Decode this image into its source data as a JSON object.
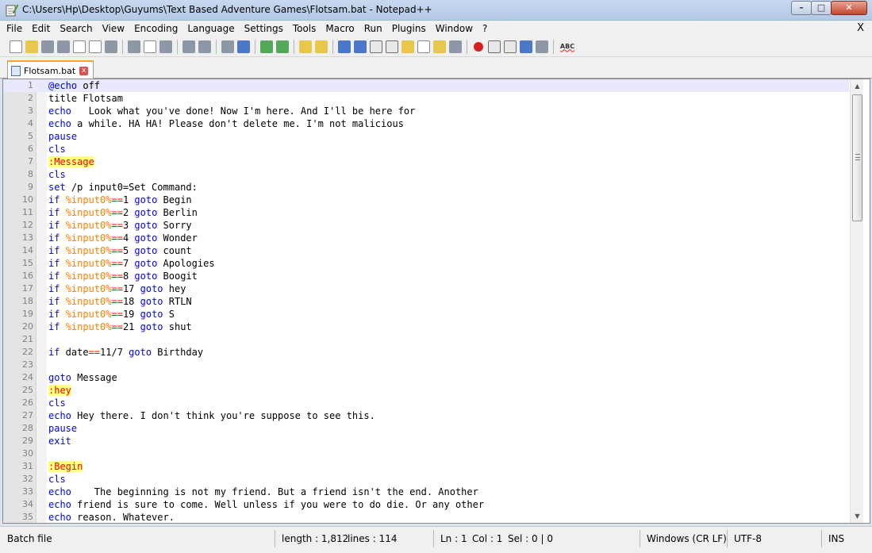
{
  "window": {
    "title": "C:\\Users\\Hp\\Desktop\\Guyums\\Text Based Adventure Games\\Flotsam.bat - Notepad++",
    "minimize": "–",
    "maximize": "□",
    "close": "✕"
  },
  "menu": {
    "items": [
      "File",
      "Edit",
      "Search",
      "View",
      "Encoding",
      "Language",
      "Settings",
      "Tools",
      "Macro",
      "Run",
      "Plugins",
      "Window",
      "?"
    ],
    "close_doc": "X"
  },
  "toolbar": {
    "icons": [
      "new-file-icon",
      "open-file-icon",
      "save-icon",
      "save-all-icon",
      "close-icon",
      "close-all-icon",
      "print-icon",
      "cut-icon",
      "copy-icon",
      "paste-icon",
      "undo-icon",
      "redo-icon",
      "find-icon",
      "replace-icon",
      "zoom-in-icon",
      "zoom-out-icon",
      "sync-vertical-icon",
      "sync-horizontal-icon",
      "word-wrap-icon",
      "show-all-chars-icon",
      "indent-guide-icon",
      "user-defined-language-icon",
      "doc-map-icon",
      "function-list-icon",
      "folder-as-workspace-icon",
      "monitor-icon",
      "record-macro-icon",
      "stop-record-icon",
      "play-macro-icon",
      "run-macro-multiple-icon",
      "save-macro-icon",
      "spell-check-icon"
    ],
    "spell_check_label": "ABC"
  },
  "tab": {
    "label": "Flotsam.bat",
    "close": "x"
  },
  "editor": {
    "lines": [
      [
        {
          "t": "@echo",
          "c": "kw"
        },
        {
          "t": " off",
          "c": ""
        }
      ],
      [
        {
          "t": "title Flotsam",
          "c": ""
        }
      ],
      [
        {
          "t": "echo",
          "c": "kw"
        },
        {
          "t": "   Look what you've done! Now I'm here. And I'll be here for",
          "c": ""
        }
      ],
      [
        {
          "t": "echo",
          "c": "kw"
        },
        {
          "t": " a while. HA HA! Please don't delete me. I'm not malicious",
          "c": ""
        }
      ],
      [
        {
          "t": "pause",
          "c": "kw"
        }
      ],
      [
        {
          "t": "cls",
          "c": "kw"
        }
      ],
      [
        {
          "t": ":Message",
          "c": "lbl"
        }
      ],
      [
        {
          "t": "cls",
          "c": "kw"
        }
      ],
      [
        {
          "t": "set",
          "c": "kw"
        },
        {
          "t": " /p input0=Set Command:",
          "c": ""
        }
      ],
      [
        {
          "t": "if",
          "c": "kw"
        },
        {
          "t": " ",
          "c": ""
        },
        {
          "t": "%input0%",
          "c": "var"
        },
        {
          "t": "==",
          "c": "op"
        },
        {
          "t": "1 ",
          "c": ""
        },
        {
          "t": "goto",
          "c": "kw"
        },
        {
          "t": " Begin",
          "c": ""
        }
      ],
      [
        {
          "t": "if",
          "c": "kw"
        },
        {
          "t": " ",
          "c": ""
        },
        {
          "t": "%input0%",
          "c": "var"
        },
        {
          "t": "==",
          "c": "op"
        },
        {
          "t": "2 ",
          "c": ""
        },
        {
          "t": "goto",
          "c": "kw"
        },
        {
          "t": " Berlin",
          "c": ""
        }
      ],
      [
        {
          "t": "if",
          "c": "kw"
        },
        {
          "t": " ",
          "c": ""
        },
        {
          "t": "%input0%",
          "c": "var"
        },
        {
          "t": "==",
          "c": "op"
        },
        {
          "t": "3 ",
          "c": ""
        },
        {
          "t": "goto",
          "c": "kw"
        },
        {
          "t": " Sorry",
          "c": ""
        }
      ],
      [
        {
          "t": "if",
          "c": "kw"
        },
        {
          "t": " ",
          "c": ""
        },
        {
          "t": "%input0%",
          "c": "var"
        },
        {
          "t": "==",
          "c": "op"
        },
        {
          "t": "4 ",
          "c": ""
        },
        {
          "t": "goto",
          "c": "kw"
        },
        {
          "t": " Wonder",
          "c": ""
        }
      ],
      [
        {
          "t": "if",
          "c": "kw"
        },
        {
          "t": " ",
          "c": ""
        },
        {
          "t": "%input0%",
          "c": "var"
        },
        {
          "t": "==",
          "c": "op"
        },
        {
          "t": "5 ",
          "c": ""
        },
        {
          "t": "goto",
          "c": "kw"
        },
        {
          "t": " count",
          "c": ""
        }
      ],
      [
        {
          "t": "if",
          "c": "kw"
        },
        {
          "t": " ",
          "c": ""
        },
        {
          "t": "%input0%",
          "c": "var"
        },
        {
          "t": "==",
          "c": "op"
        },
        {
          "t": "7 ",
          "c": ""
        },
        {
          "t": "goto",
          "c": "kw"
        },
        {
          "t": " Apologies",
          "c": ""
        }
      ],
      [
        {
          "t": "if",
          "c": "kw"
        },
        {
          "t": " ",
          "c": ""
        },
        {
          "t": "%input0%",
          "c": "var"
        },
        {
          "t": "==",
          "c": "op"
        },
        {
          "t": "8 ",
          "c": ""
        },
        {
          "t": "goto",
          "c": "kw"
        },
        {
          "t": " Boogit",
          "c": ""
        }
      ],
      [
        {
          "t": "if",
          "c": "kw"
        },
        {
          "t": " ",
          "c": ""
        },
        {
          "t": "%input0%",
          "c": "var"
        },
        {
          "t": "==",
          "c": "op"
        },
        {
          "t": "17 ",
          "c": ""
        },
        {
          "t": "goto",
          "c": "kw"
        },
        {
          "t": " hey",
          "c": ""
        }
      ],
      [
        {
          "t": "if",
          "c": "kw"
        },
        {
          "t": " ",
          "c": ""
        },
        {
          "t": "%input0%",
          "c": "var"
        },
        {
          "t": "==",
          "c": "op"
        },
        {
          "t": "18 ",
          "c": ""
        },
        {
          "t": "goto",
          "c": "kw"
        },
        {
          "t": " RTLN",
          "c": ""
        }
      ],
      [
        {
          "t": "if",
          "c": "kw"
        },
        {
          "t": " ",
          "c": ""
        },
        {
          "t": "%input0%",
          "c": "var"
        },
        {
          "t": "==",
          "c": "op"
        },
        {
          "t": "19 ",
          "c": ""
        },
        {
          "t": "goto",
          "c": "kw"
        },
        {
          "t": " S",
          "c": ""
        }
      ],
      [
        {
          "t": "if",
          "c": "kw"
        },
        {
          "t": " ",
          "c": ""
        },
        {
          "t": "%input0%",
          "c": "var"
        },
        {
          "t": "==",
          "c": "op"
        },
        {
          "t": "21 ",
          "c": ""
        },
        {
          "t": "goto",
          "c": "kw"
        },
        {
          "t": " shut",
          "c": ""
        }
      ],
      [],
      [
        {
          "t": "if",
          "c": "kw"
        },
        {
          "t": " date",
          "c": ""
        },
        {
          "t": "==",
          "c": "op"
        },
        {
          "t": "11/7 ",
          "c": ""
        },
        {
          "t": "goto",
          "c": "kw"
        },
        {
          "t": " Birthday",
          "c": ""
        }
      ],
      [],
      [
        {
          "t": "goto",
          "c": "kw"
        },
        {
          "t": " Message",
          "c": ""
        }
      ],
      [
        {
          "t": ":hey",
          "c": "lbl"
        }
      ],
      [
        {
          "t": "cls",
          "c": "kw"
        }
      ],
      [
        {
          "t": "echo",
          "c": "kw"
        },
        {
          "t": " Hey there. I don't think you're suppose to see this.",
          "c": ""
        }
      ],
      [
        {
          "t": "pause",
          "c": "kw"
        }
      ],
      [
        {
          "t": "exit",
          "c": "kw"
        }
      ],
      [],
      [
        {
          "t": ":Begin",
          "c": "lbl"
        }
      ],
      [
        {
          "t": "cls",
          "c": "kw"
        }
      ],
      [
        {
          "t": "echo",
          "c": "kw"
        },
        {
          "t": "    The beginning is not my friend. But a friend isn't the end. Another",
          "c": ""
        }
      ],
      [
        {
          "t": "echo",
          "c": "kw"
        },
        {
          "t": " friend is sure to come. Well unless if you were to do die. Or any other",
          "c": ""
        }
      ],
      [
        {
          "t": "echo",
          "c": "kw"
        },
        {
          "t": " reason. Whatever.",
          "c": ""
        }
      ]
    ],
    "current_line": 1,
    "colors": {
      "keyword": "#0000ff",
      "label_fg": "#ff0000",
      "label_bg": "#ffff80",
      "variable": "#ff8000",
      "operator": "#ff0000",
      "current_line_bg": "#e8e8ff"
    }
  },
  "status": {
    "file_type": "Batch file",
    "length": "length : 1,812",
    "lines": "lines : 114",
    "ln": "Ln : 1",
    "col": "Col : 1",
    "sel": "Sel : 0 | 0",
    "eol": "Windows (CR LF)",
    "encoding": "UTF-8",
    "mode": "INS"
  }
}
